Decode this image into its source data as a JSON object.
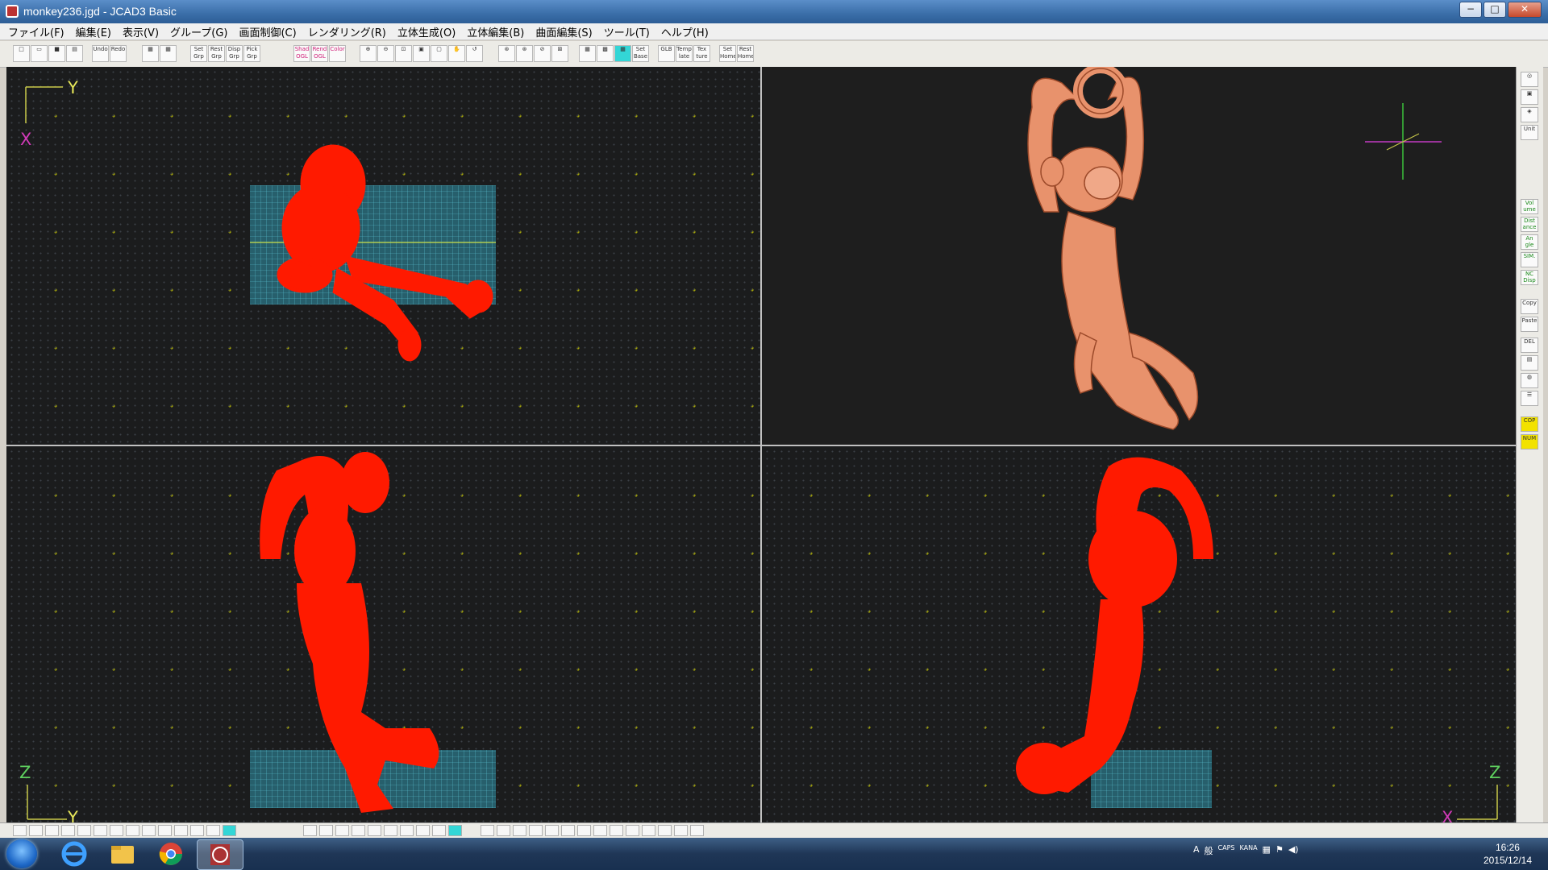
{
  "window": {
    "title": "monkey236.jgd - JCAD3 Basic",
    "controls": [
      "−",
      "□",
      "✕"
    ]
  },
  "menubar": {
    "items": [
      "ファイル(F)",
      "編集(E)",
      "表示(V)",
      "グループ(G)",
      "画面制御(C)",
      "レンダリング(R)",
      "立体生成(O)",
      "立体編集(B)",
      "曲面編集(S)",
      "ツール(T)",
      "ヘルプ(H)"
    ]
  },
  "toolbar": {
    "labeled_buttons": [
      "Undo",
      "Redo",
      "Set Grp",
      "Rest Grp",
      "Disp Grp",
      "Pick Grp",
      "Shad OGL",
      "Rend OGL",
      "Color",
      "Set Base",
      "GLB",
      "Temp late",
      "Tex ture",
      "Set Home",
      "Rest Home"
    ]
  },
  "viewports": {
    "top": {
      "axis_h": "Y",
      "axis_v": "X"
    },
    "front": {
      "axis_v": "Z",
      "axis_h": "Y"
    },
    "side": {
      "axis_v": "Z",
      "axis_h": "X"
    }
  },
  "sidepanel": {
    "buttons": [
      "Unit",
      "Vol ume",
      "Dist ance",
      "An gle",
      "SIM.",
      "NC Disp",
      "Copy",
      "Paste",
      "DEL",
      "COP",
      "NUM"
    ]
  },
  "taskbar": {
    "tray_text": [
      "A",
      "般",
      "CAPS",
      "KANA"
    ],
    "time": "16:26",
    "date": "2015/12/14"
  },
  "colors": {
    "wire": "#ff1a00",
    "grid_fill": "#2f7f8f",
    "render": "#e8926c",
    "axis": "#c9c94a"
  }
}
